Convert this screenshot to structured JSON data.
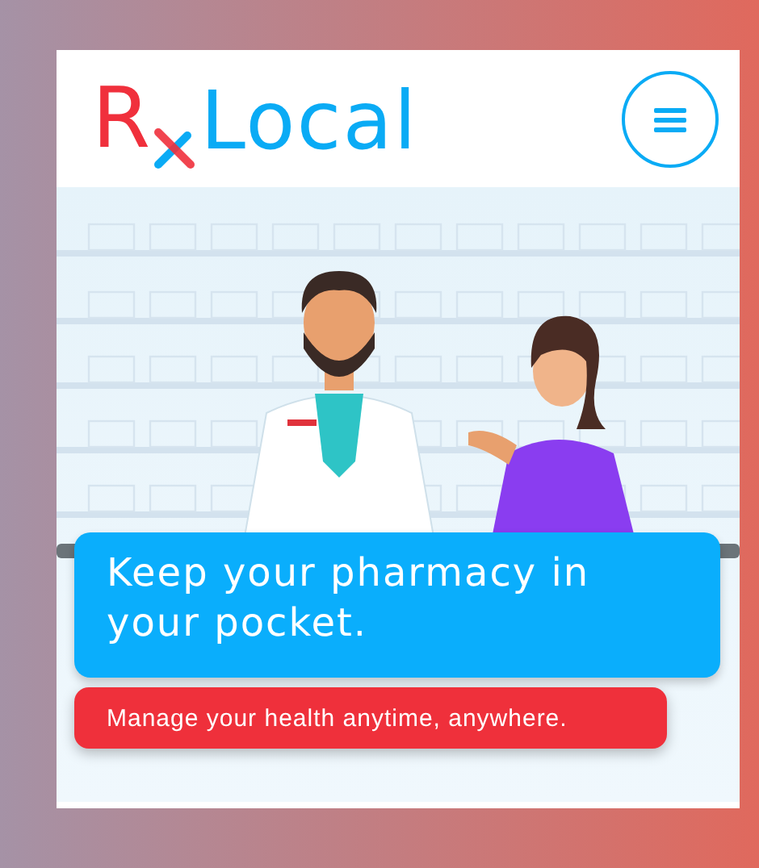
{
  "header": {
    "logo_mark": "R",
    "logo_name": "Local"
  },
  "hero": {
    "headline": "Keep your pharmacy in your pocket.",
    "tagline": "Manage your health anytime, anywhere."
  }
}
